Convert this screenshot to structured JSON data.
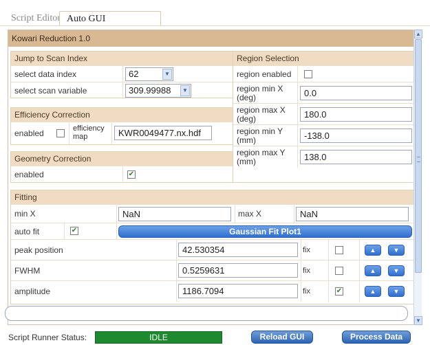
{
  "tabs": [
    {
      "label": "Script Editor",
      "active": false
    },
    {
      "label": "Auto GUI",
      "active": true
    }
  ],
  "title": "Kowari Reduction 1.0",
  "jump": {
    "header": "Jump to Scan Index",
    "index_label": "select data index",
    "index_value": "62",
    "var_label": "select scan variable",
    "var_value": "309.99988"
  },
  "efficiency": {
    "header": "Efficiency Correction",
    "enabled_label": "enabled",
    "enabled": false,
    "map_label_1": "efficiency",
    "map_label_2": "map",
    "map_value": "KWR0049477.nx.hdf"
  },
  "geometry": {
    "header": "Geometry Correction",
    "enabled_label": "enabled",
    "enabled": true
  },
  "region": {
    "header": "Region Selection",
    "enabled_label": "region enabled",
    "enabled": false,
    "minx_label_1": "region min X",
    "minx_label_2": "(deg)",
    "minx": "0.0",
    "maxx_label_1": "region max X",
    "maxx_label_2": "(deg)",
    "maxx": "180.0",
    "miny_label_1": "region min Y",
    "miny_label_2": "(mm)",
    "miny": "-138.0",
    "maxy_label_1": "region max Y",
    "maxy_label_2": "(mm)",
    "maxy": "138.0"
  },
  "fitting": {
    "header": "Fitting",
    "minx_label": "min X",
    "minx": "NaN",
    "maxx_label": "max X",
    "maxx": "NaN",
    "autofit_label": "auto fit",
    "autofit": true,
    "fit_button": "Gaussian Fit Plot1",
    "params": [
      {
        "label": "peak position",
        "value": "42.530354",
        "fix_label": "fix",
        "fix": false
      },
      {
        "label": "FWHM",
        "value": "0.5259631",
        "fix_label": "fix",
        "fix": false
      },
      {
        "label": "amplitude",
        "value": "1186.7094",
        "fix_label": "fix",
        "fix": true
      }
    ]
  },
  "status": {
    "label": "Script Runner Status:",
    "value": "IDLE",
    "color": "#1e8a2f"
  },
  "buttons": {
    "reload": "Reload GUI",
    "process": "Process Data"
  },
  "glyphs": {
    "up": "▲",
    "down": "▼",
    "check": "✔"
  }
}
